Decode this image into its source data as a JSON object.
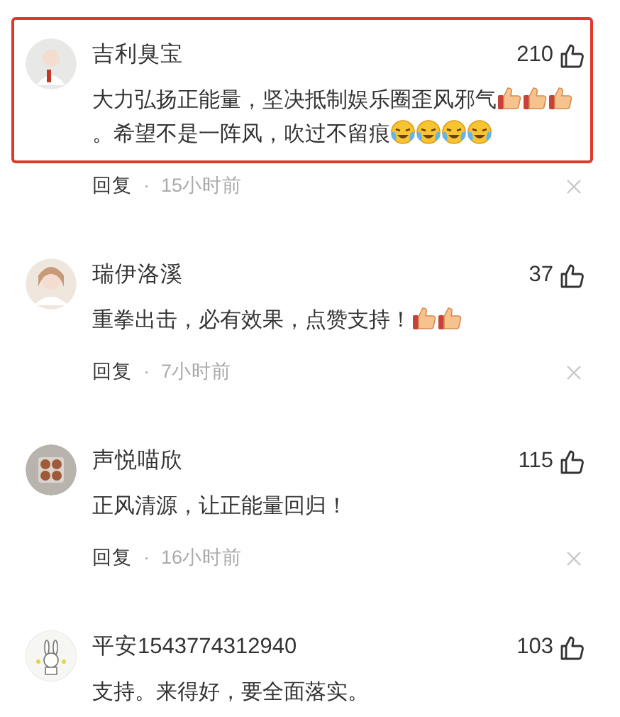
{
  "comments": [
    {
      "name": "吉利臭宝",
      "likes": "210",
      "highlighted": true,
      "content": [
        {
          "kind": "text",
          "text": "大力弘扬正能量，坚决抵制娱乐圈歪风邪气"
        },
        {
          "kind": "like"
        },
        {
          "kind": "like"
        },
        {
          "kind": "like"
        },
        {
          "kind": "text",
          "text": "。希望不是一阵风，吹过不留痕"
        },
        {
          "kind": "cry"
        },
        {
          "kind": "cry"
        },
        {
          "kind": "cry"
        },
        {
          "kind": "cry"
        }
      ],
      "reply": "回复",
      "separator": "·",
      "time": "15小时前"
    },
    {
      "name": "瑞伊洛溪",
      "likes": "37",
      "highlighted": false,
      "content": [
        {
          "kind": "text",
          "text": "重拳出击，必有效果，点赞支持！"
        },
        {
          "kind": "like"
        },
        {
          "kind": "like"
        }
      ],
      "reply": "回复",
      "separator": "·",
      "time": "7小时前"
    },
    {
      "name": "声悦喵欣",
      "likes": "115",
      "highlighted": false,
      "content": [
        {
          "kind": "text",
          "text": "正风清源，让正能量回归！"
        }
      ],
      "reply": "回复",
      "separator": "·",
      "time": "16小时前"
    },
    {
      "name": "平安1543774312940",
      "likes": "103",
      "highlighted": false,
      "content": [
        {
          "kind": "text",
          "text": "支持。来得好，要全面落实。"
        }
      ]
    }
  ]
}
